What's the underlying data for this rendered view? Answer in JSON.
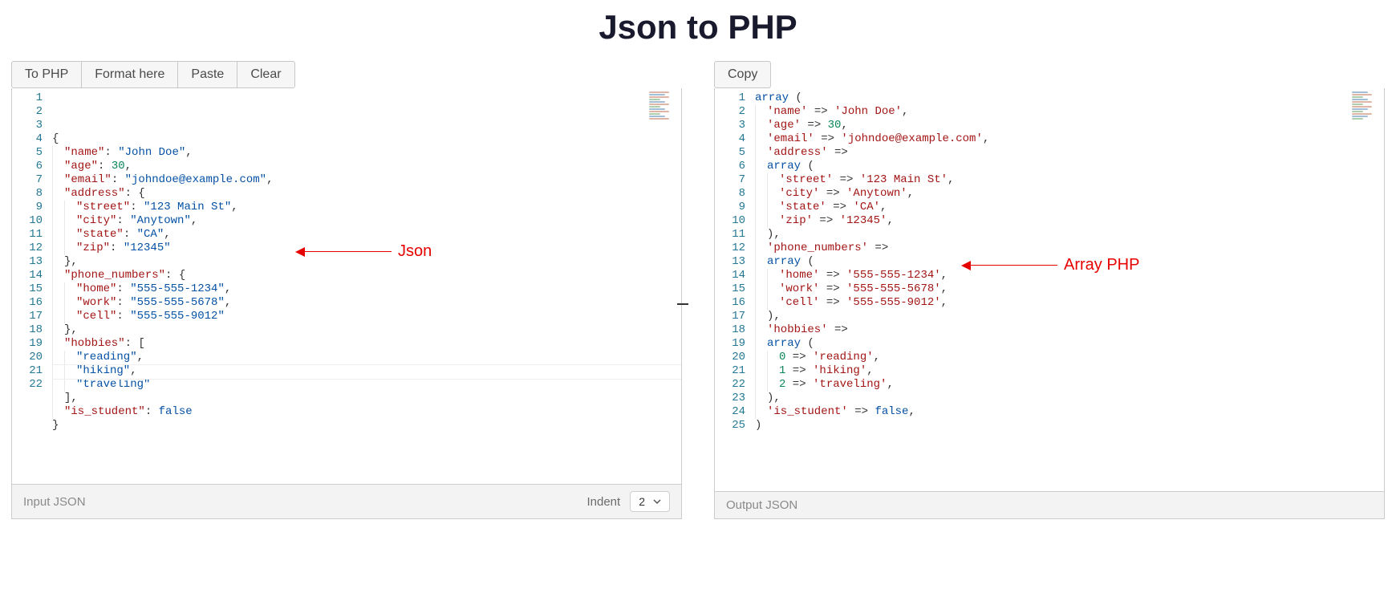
{
  "title": "Json to PHP",
  "left": {
    "buttons": {
      "to_php": "To PHP",
      "format": "Format here",
      "paste": "Paste",
      "clear": "Clear"
    },
    "footer_label": "Input JSON",
    "indent_label": "Indent",
    "indent_value": "2",
    "cursor_line": 21,
    "line_count": 22,
    "lines": [
      {
        "indent": 0,
        "tokens": [
          {
            "t": "{",
            "c": "p"
          }
        ]
      },
      {
        "indent": 1,
        "tokens": [
          {
            "t": "\"name\"",
            "c": "k"
          },
          {
            "t": ": ",
            "c": "p"
          },
          {
            "t": "\"John Doe\"",
            "c": "s"
          },
          {
            "t": ",",
            "c": "p"
          }
        ]
      },
      {
        "indent": 1,
        "tokens": [
          {
            "t": "\"age\"",
            "c": "k"
          },
          {
            "t": ": ",
            "c": "p"
          },
          {
            "t": "30",
            "c": "n"
          },
          {
            "t": ",",
            "c": "p"
          }
        ]
      },
      {
        "indent": 1,
        "tokens": [
          {
            "t": "\"email\"",
            "c": "k"
          },
          {
            "t": ": ",
            "c": "p"
          },
          {
            "t": "\"johndoe@example.com\"",
            "c": "s"
          },
          {
            "t": ",",
            "c": "p"
          }
        ]
      },
      {
        "indent": 1,
        "tokens": [
          {
            "t": "\"address\"",
            "c": "k"
          },
          {
            "t": ": {",
            "c": "p"
          }
        ]
      },
      {
        "indent": 2,
        "tokens": [
          {
            "t": "\"street\"",
            "c": "k"
          },
          {
            "t": ": ",
            "c": "p"
          },
          {
            "t": "\"123 Main St\"",
            "c": "s"
          },
          {
            "t": ",",
            "c": "p"
          }
        ]
      },
      {
        "indent": 2,
        "tokens": [
          {
            "t": "\"city\"",
            "c": "k"
          },
          {
            "t": ": ",
            "c": "p"
          },
          {
            "t": "\"Anytown\"",
            "c": "s"
          },
          {
            "t": ",",
            "c": "p"
          }
        ]
      },
      {
        "indent": 2,
        "tokens": [
          {
            "t": "\"state\"",
            "c": "k"
          },
          {
            "t": ": ",
            "c": "p"
          },
          {
            "t": "\"CA\"",
            "c": "s"
          },
          {
            "t": ",",
            "c": "p"
          }
        ]
      },
      {
        "indent": 2,
        "tokens": [
          {
            "t": "\"zip\"",
            "c": "k"
          },
          {
            "t": ": ",
            "c": "p"
          },
          {
            "t": "\"12345\"",
            "c": "s"
          }
        ]
      },
      {
        "indent": 1,
        "tokens": [
          {
            "t": "},",
            "c": "p"
          }
        ]
      },
      {
        "indent": 1,
        "tokens": [
          {
            "t": "\"phone_numbers\"",
            "c": "k"
          },
          {
            "t": ": {",
            "c": "p"
          }
        ]
      },
      {
        "indent": 2,
        "tokens": [
          {
            "t": "\"home\"",
            "c": "k"
          },
          {
            "t": ": ",
            "c": "p"
          },
          {
            "t": "\"555-555-1234\"",
            "c": "s"
          },
          {
            "t": ",",
            "c": "p"
          }
        ]
      },
      {
        "indent": 2,
        "tokens": [
          {
            "t": "\"work\"",
            "c": "k"
          },
          {
            "t": ": ",
            "c": "p"
          },
          {
            "t": "\"555-555-5678\"",
            "c": "s"
          },
          {
            "t": ",",
            "c": "p"
          }
        ]
      },
      {
        "indent": 2,
        "tokens": [
          {
            "t": "\"cell\"",
            "c": "k"
          },
          {
            "t": ": ",
            "c": "p"
          },
          {
            "t": "\"555-555-9012\"",
            "c": "s"
          }
        ]
      },
      {
        "indent": 1,
        "tokens": [
          {
            "t": "},",
            "c": "p"
          }
        ]
      },
      {
        "indent": 1,
        "tokens": [
          {
            "t": "\"hobbies\"",
            "c": "k"
          },
          {
            "t": ": [",
            "c": "p"
          }
        ]
      },
      {
        "indent": 2,
        "tokens": [
          {
            "t": "\"reading\"",
            "c": "s"
          },
          {
            "t": ",",
            "c": "p"
          }
        ]
      },
      {
        "indent": 2,
        "tokens": [
          {
            "t": "\"hiking\"",
            "c": "s"
          },
          {
            "t": ",",
            "c": "p"
          }
        ]
      },
      {
        "indent": 2,
        "tokens": [
          {
            "t": "\"traveling\"",
            "c": "s"
          }
        ]
      },
      {
        "indent": 1,
        "tokens": [
          {
            "t": "],",
            "c": "p"
          }
        ]
      },
      {
        "indent": 1,
        "tokens": [
          {
            "t": "\"is_student\"",
            "c": "k"
          },
          {
            "t": ": ",
            "c": "p"
          },
          {
            "t": "false",
            "c": "b"
          }
        ]
      },
      {
        "indent": 0,
        "tokens": [
          {
            "t": "}",
            "c": "p"
          }
        ]
      }
    ]
  },
  "right": {
    "buttons": {
      "copy": "Copy"
    },
    "footer_label": "Output JSON",
    "line_count": 25,
    "lines": [
      {
        "indent": 0,
        "tokens": [
          {
            "t": "array",
            "c": "s"
          },
          {
            "t": " (",
            "c": "p"
          }
        ]
      },
      {
        "indent": 1,
        "tokens": [
          {
            "t": "'name'",
            "c": "k"
          },
          {
            "t": " => ",
            "c": "p"
          },
          {
            "t": "'John Doe'",
            "c": "k"
          },
          {
            "t": ",",
            "c": "p"
          }
        ]
      },
      {
        "indent": 1,
        "tokens": [
          {
            "t": "'age'",
            "c": "k"
          },
          {
            "t": " => ",
            "c": "p"
          },
          {
            "t": "30",
            "c": "n"
          },
          {
            "t": ",",
            "c": "p"
          }
        ]
      },
      {
        "indent": 1,
        "tokens": [
          {
            "t": "'email'",
            "c": "k"
          },
          {
            "t": " => ",
            "c": "p"
          },
          {
            "t": "'johndoe@example.com'",
            "c": "k"
          },
          {
            "t": ",",
            "c": "p"
          }
        ]
      },
      {
        "indent": 1,
        "tokens": [
          {
            "t": "'address'",
            "c": "k"
          },
          {
            "t": " =>",
            "c": "p"
          }
        ]
      },
      {
        "indent": 1,
        "tokens": [
          {
            "t": "array",
            "c": "s"
          },
          {
            "t": " (",
            "c": "p"
          }
        ]
      },
      {
        "indent": 2,
        "tokens": [
          {
            "t": "'street'",
            "c": "k"
          },
          {
            "t": " => ",
            "c": "p"
          },
          {
            "t": "'123 Main St'",
            "c": "k"
          },
          {
            "t": ",",
            "c": "p"
          }
        ]
      },
      {
        "indent": 2,
        "tokens": [
          {
            "t": "'city'",
            "c": "k"
          },
          {
            "t": " => ",
            "c": "p"
          },
          {
            "t": "'Anytown'",
            "c": "k"
          },
          {
            "t": ",",
            "c": "p"
          }
        ]
      },
      {
        "indent": 2,
        "tokens": [
          {
            "t": "'state'",
            "c": "k"
          },
          {
            "t": " => ",
            "c": "p"
          },
          {
            "t": "'CA'",
            "c": "k"
          },
          {
            "t": ",",
            "c": "p"
          }
        ]
      },
      {
        "indent": 2,
        "tokens": [
          {
            "t": "'zip'",
            "c": "k"
          },
          {
            "t": " => ",
            "c": "p"
          },
          {
            "t": "'12345'",
            "c": "k"
          },
          {
            "t": ",",
            "c": "p"
          }
        ]
      },
      {
        "indent": 1,
        "tokens": [
          {
            "t": "),",
            "c": "p"
          }
        ]
      },
      {
        "indent": 1,
        "tokens": [
          {
            "t": "'phone_numbers'",
            "c": "k"
          },
          {
            "t": " =>",
            "c": "p"
          }
        ]
      },
      {
        "indent": 1,
        "tokens": [
          {
            "t": "array",
            "c": "s"
          },
          {
            "t": " (",
            "c": "p"
          }
        ]
      },
      {
        "indent": 2,
        "tokens": [
          {
            "t": "'home'",
            "c": "k"
          },
          {
            "t": " => ",
            "c": "p"
          },
          {
            "t": "'555-555-1234'",
            "c": "k"
          },
          {
            "t": ",",
            "c": "p"
          }
        ]
      },
      {
        "indent": 2,
        "tokens": [
          {
            "t": "'work'",
            "c": "k"
          },
          {
            "t": " => ",
            "c": "p"
          },
          {
            "t": "'555-555-5678'",
            "c": "k"
          },
          {
            "t": ",",
            "c": "p"
          }
        ]
      },
      {
        "indent": 2,
        "tokens": [
          {
            "t": "'cell'",
            "c": "k"
          },
          {
            "t": " => ",
            "c": "p"
          },
          {
            "t": "'555-555-9012'",
            "c": "k"
          },
          {
            "t": ",",
            "c": "p"
          }
        ]
      },
      {
        "indent": 1,
        "tokens": [
          {
            "t": "),",
            "c": "p"
          }
        ]
      },
      {
        "indent": 1,
        "tokens": [
          {
            "t": "'hobbies'",
            "c": "k"
          },
          {
            "t": " =>",
            "c": "p"
          }
        ]
      },
      {
        "indent": 1,
        "tokens": [
          {
            "t": "array",
            "c": "s"
          },
          {
            "t": " (",
            "c": "p"
          }
        ]
      },
      {
        "indent": 2,
        "tokens": [
          {
            "t": "0",
            "c": "n"
          },
          {
            "t": " => ",
            "c": "p"
          },
          {
            "t": "'reading'",
            "c": "k"
          },
          {
            "t": ",",
            "c": "p"
          }
        ]
      },
      {
        "indent": 2,
        "tokens": [
          {
            "t": "1",
            "c": "n"
          },
          {
            "t": " => ",
            "c": "p"
          },
          {
            "t": "'hiking'",
            "c": "k"
          },
          {
            "t": ",",
            "c": "p"
          }
        ]
      },
      {
        "indent": 2,
        "tokens": [
          {
            "t": "2",
            "c": "n"
          },
          {
            "t": " => ",
            "c": "p"
          },
          {
            "t": "'traveling'",
            "c": "k"
          },
          {
            "t": ",",
            "c": "p"
          }
        ]
      },
      {
        "indent": 1,
        "tokens": [
          {
            "t": "),",
            "c": "p"
          }
        ]
      },
      {
        "indent": 1,
        "tokens": [
          {
            "t": "'is_student'",
            "c": "k"
          },
          {
            "t": " => ",
            "c": "p"
          },
          {
            "t": "false",
            "c": "b"
          },
          {
            "t": ",",
            "c": "p"
          }
        ]
      },
      {
        "indent": 0,
        "tokens": [
          {
            "t": ")",
            "c": "p"
          }
        ]
      }
    ]
  },
  "annotations": {
    "json_label": "Json",
    "php_label": "Array PHP"
  }
}
